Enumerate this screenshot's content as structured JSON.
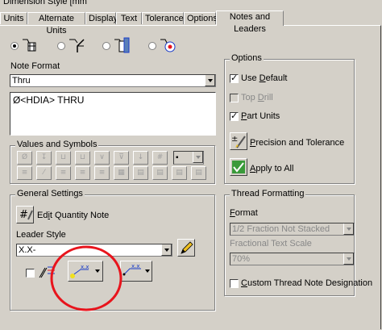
{
  "window": {
    "title_fragment": "Dimension Style [mm"
  },
  "tabs": [
    {
      "label": "Units"
    },
    {
      "label": "Alternate Units"
    },
    {
      "label": "Display"
    },
    {
      "label": "Text"
    },
    {
      "label": "Tolerance"
    },
    {
      "label": "Options"
    },
    {
      "label": "Notes and Leaders"
    }
  ],
  "active_tab": "Notes and Leaders",
  "note_format": {
    "label": "Note Format",
    "selected": "Thru",
    "text": "Ø<HDIA> THRU"
  },
  "values_symbols": {
    "title": "Values and Symbols"
  },
  "general": {
    "title": "General Settings",
    "edit_quantity_note": "Edit Quantity Note",
    "leader_style_label": "Leader Style",
    "leader_style_value": "X.X-"
  },
  "options": {
    "title": "Options",
    "use_default": {
      "label": "Use Default",
      "checked": true
    },
    "top_drill": {
      "label": "Top Drill",
      "checked": false,
      "enabled": false
    },
    "part_units": {
      "label": "Part Units",
      "checked": true
    },
    "precision_label": "Precision and Tolerance",
    "apply_label": "Apply to All"
  },
  "thread": {
    "title": "Thread Formatting",
    "format_label": "Format",
    "format_value": "1/2 Fraction Not Stacked",
    "scale_label": "Fractional Text Scale",
    "scale_value": "70%",
    "custom_label": "Custom Thread Note Designation",
    "custom_checked": false
  },
  "colors": {
    "annotation_circle": "#e8141c",
    "leader_blue": "#1a3cc8"
  }
}
